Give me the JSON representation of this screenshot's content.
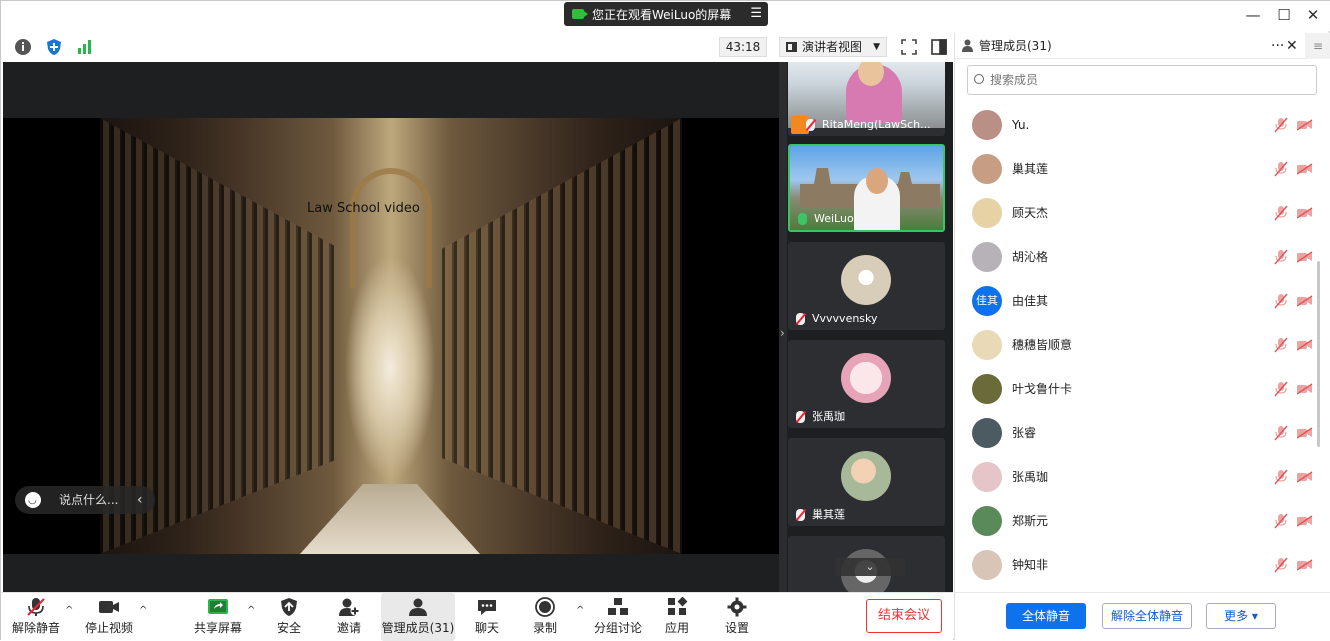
{
  "title_bar": {
    "share_banner": "您正在观看WeiLuo的屏幕",
    "controls": [
      "—",
      "☐",
      "✕"
    ]
  },
  "toolbar": {
    "timer": "43:18",
    "view_mode": "演讲者视图"
  },
  "shared_content": {
    "caption": "Law School video",
    "chat_placeholder": "说点什么..."
  },
  "gallery": {
    "tiles": [
      {
        "name": "RitaMeng(LawSch...",
        "mic": "off"
      },
      {
        "name": "WeiLuo",
        "mic": "on",
        "active": true
      },
      {
        "name": "Vvvvvensky",
        "mic": "off"
      },
      {
        "name": "张禹珈",
        "mic": "off"
      },
      {
        "name": "巢其莲",
        "mic": "off"
      }
    ]
  },
  "bottom_toolbar": {
    "unmute": "解除静音",
    "stop_video": "停止视频",
    "share_screen": "共享屏幕",
    "security": "安全",
    "invite": "邀请",
    "manage_participants": "管理成员(31)",
    "chat": "聊天",
    "record": "录制",
    "breakout": "分组讨论",
    "apps": "应用",
    "settings": "设置",
    "end_meeting": "结束会议"
  },
  "participants_panel": {
    "title": "管理成员(31)",
    "search_placeholder": "搜索成员",
    "participants": [
      {
        "name": "Yu.",
        "avatar_color": "#b98f86"
      },
      {
        "name": "巢其莲",
        "avatar_color": "#c79d83"
      },
      {
        "name": "顾天杰",
        "avatar_color": "#e7d2a6"
      },
      {
        "name": "胡沁格",
        "avatar_color": "#b6b2b8"
      },
      {
        "name": "由佳其",
        "avatar_color": "#0e72ed",
        "initials": "佳其"
      },
      {
        "name": "穗穗皆顺意",
        "avatar_color": "#ead9b7"
      },
      {
        "name": "叶戈鲁什卡",
        "avatar_color": "#6b6a3a"
      },
      {
        "name": "张睿",
        "avatar_color": "#4c5a61"
      },
      {
        "name": "张禹珈",
        "avatar_color": "#e6c5c9"
      },
      {
        "name": "郑斯元",
        "avatar_color": "#5a8a5a"
      },
      {
        "name": "钟知非",
        "avatar_color": "#d9c4b8"
      }
    ],
    "mute_all": "全体静音",
    "unmute_all": "解除全体静音",
    "more": "更多 ▾"
  },
  "colors": {
    "accent": "#0e72ed",
    "active_speaker": "#3cc465",
    "end_red": "#ee3333"
  }
}
